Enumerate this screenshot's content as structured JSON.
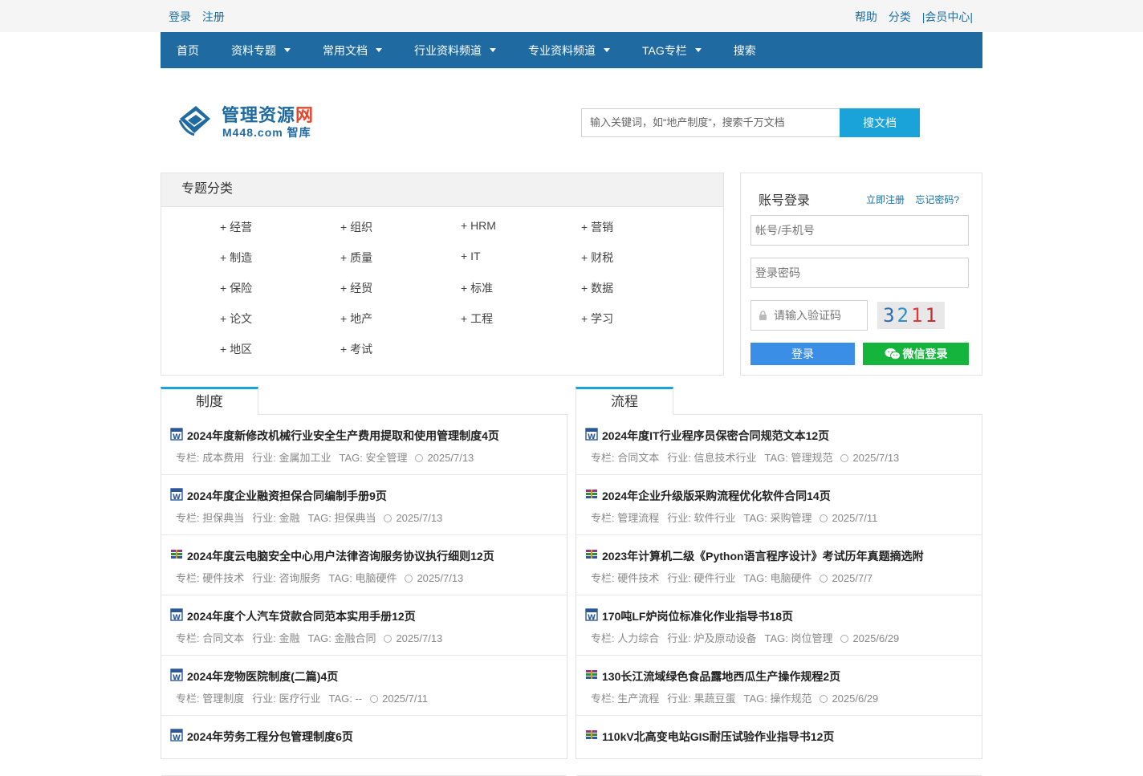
{
  "topbar": {
    "login": "登录",
    "register": "注册",
    "help": "帮助",
    "category": "分类",
    "member": "|会员中心|"
  },
  "nav": {
    "items": [
      {
        "label": "首页"
      },
      {
        "label": "资料专题"
      },
      {
        "label": "常用文档"
      },
      {
        "label": "行业资料频道"
      },
      {
        "label": "专业资料频道"
      },
      {
        "label": "TAG专栏"
      },
      {
        "label": "搜索"
      }
    ]
  },
  "header": {
    "logo_title_a": "管理资源",
    "logo_title_b": "网",
    "logo_sub": "M448.com 智库",
    "search_placeholder": "输入关键词，如“地产制度”，搜索千万文档",
    "search_button": "搜文档"
  },
  "categories": {
    "title": "专题分类",
    "items": [
      "+ 经营",
      "+ 组织",
      "+ HRM",
      "+ 营销",
      "+ 制造",
      "+ 质量",
      "+ IT",
      "+ 财税",
      "+ 保险",
      "+ 经贸",
      "+ 标准",
      "+ 数据",
      "+ 论文",
      "+ 地产",
      "+ 工程",
      "+ 学习",
      "+ 地区",
      "+ 考试"
    ]
  },
  "login": {
    "title": "账号登录",
    "register_link": "立即注册",
    "forgot_link": "忘记密码?",
    "account_placeholder": "帐号/手机号",
    "password_placeholder": "登录密码",
    "captcha_placeholder": "请输入验证码",
    "captcha_text": "3211",
    "login_button": "登录",
    "wechat_button": "微信登录"
  },
  "panels": [
    {
      "tab": "制度",
      "items": [
        {
          "icon": "word",
          "title": "2024年度新修改机械行业安全生产费用提取和使用管理制度4页",
          "column": "专栏: 成本费用",
          "industry": "行业: 金属加工业",
          "tag": "TAG: 安全管理",
          "date": "2025/7/13"
        },
        {
          "icon": "word",
          "title": "2024年度企业融资担保合同编制手册9页",
          "column": "专栏: 担保典当",
          "industry": "行业: 金融",
          "tag": "TAG: 担保典当",
          "date": "2025/7/13"
        },
        {
          "icon": "rar",
          "title": "2024年度云电脑安全中心用户法律咨询服务协议执行细则12页",
          "column": "专栏: 硬件技术",
          "industry": "行业: 咨询服务",
          "tag": "TAG: 电脑硬件",
          "date": "2025/7/13"
        },
        {
          "icon": "word",
          "title": "2024年度个人汽车贷款合同范本实用手册12页",
          "column": "专栏: 合同文本",
          "industry": "行业: 金融",
          "tag": "TAG: 金融合同",
          "date": "2025/7/13"
        },
        {
          "icon": "word",
          "title": "2024年宠物医院制度(二篇)4页",
          "column": "专栏: 管理制度",
          "industry": "行业: 医疗行业",
          "tag": "TAG: --",
          "date": "2025/7/11"
        },
        {
          "icon": "word",
          "title": "2024年劳务工程分包管理制度6页",
          "column": "",
          "industry": "",
          "tag": "",
          "date": ""
        }
      ]
    },
    {
      "tab": "流程",
      "items": [
        {
          "icon": "word",
          "title": "2024年度IT行业程序员保密合同规范文本12页",
          "column": "专栏: 合同文本",
          "industry": "行业: 信息技术行业",
          "tag": "TAG: 管理规范",
          "date": "2025/7/13"
        },
        {
          "icon": "rar",
          "title": "2024年企业升级版采购流程优化软件合同14页",
          "column": "专栏: 管理流程",
          "industry": "行业: 软件行业",
          "tag": "TAG: 采购管理",
          "date": "2025/7/11"
        },
        {
          "icon": "rar",
          "title": "2023年计算机二级《Python语言程序设计》考试历年真题摘选附",
          "column": "专栏: 硬件技术",
          "industry": "行业: 硬件行业",
          "tag": "TAG: 电脑硬件",
          "date": "2025/7/7"
        },
        {
          "icon": "word",
          "title": "170吨LF炉岗位标准化作业指导书18页",
          "column": "专栏: 人力综合",
          "industry": "行业: 炉及原动设备",
          "tag": "TAG: 岗位管理",
          "date": "2025/6/29"
        },
        {
          "icon": "rar",
          "title": "130长江流域绿色食品露地西瓜生产操作规程2页",
          "column": "专栏: 生产流程",
          "industry": "行业: 果蔬豆蛋",
          "tag": "TAG: 操作规范",
          "date": "2025/6/29"
        },
        {
          "icon": "rar",
          "title": "110kV北高变电站GIS耐压试验作业指导书12页",
          "column": "",
          "industry": "",
          "tag": "",
          "date": ""
        }
      ]
    }
  ],
  "colors": {
    "nav_bg": "#1f6aa1",
    "search_btn": "#1aa3d9",
    "login_btn": "#3a8ee6",
    "wechat_btn": "#15b43c",
    "link": "#1a6fa8"
  }
}
